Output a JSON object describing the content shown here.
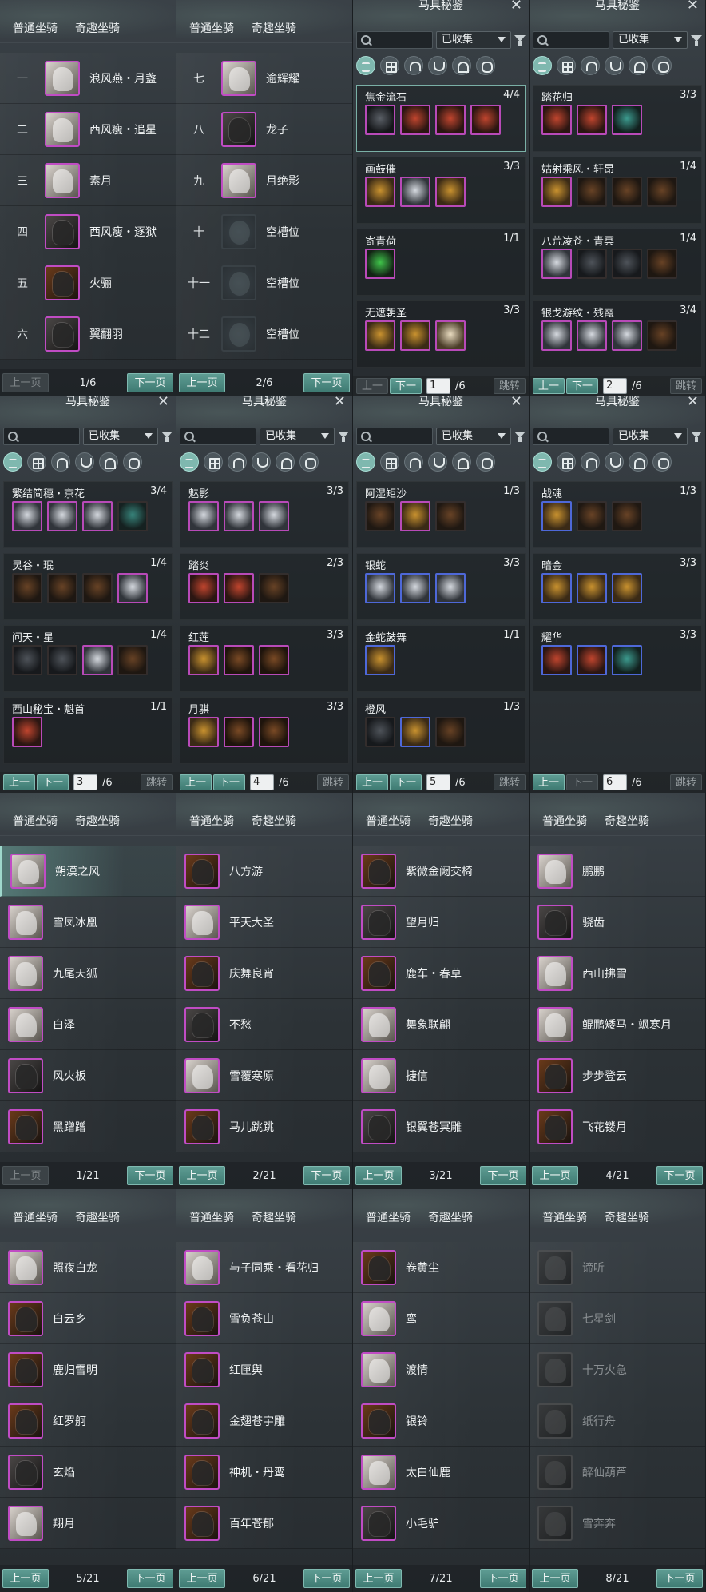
{
  "list_tabs": {
    "normal": "普通坐骑",
    "fun": "奇趣坐骑"
  },
  "nav": {
    "prev": "上一页",
    "next": "下一页",
    "jump": "跳转"
  },
  "comp": {
    "title": "马具秘鉴",
    "filter_value": "已收集",
    "total": "/6"
  },
  "panel_1": {
    "page": "1/6",
    "rows": [
      {
        "num": "一",
        "name": "浪风燕・月盏"
      },
      {
        "num": "二",
        "name": "西风瘦・追星"
      },
      {
        "num": "三",
        "name": "素月"
      },
      {
        "num": "四",
        "name": "西风瘦・逐狱"
      },
      {
        "num": "五",
        "name": "火骊"
      },
      {
        "num": "六",
        "name": "翼翻羽"
      }
    ]
  },
  "panel_2": {
    "page": "2/6",
    "rows": [
      {
        "num": "七",
        "name": "逾辉耀"
      },
      {
        "num": "八",
        "name": "龙子"
      },
      {
        "num": "九",
        "name": "月绝影"
      },
      {
        "num": "十",
        "name": "空槽位"
      },
      {
        "num": "十一",
        "name": "空槽位"
      },
      {
        "num": "十二",
        "name": "空槽位"
      }
    ]
  },
  "panel_3": {
    "page_input": "1",
    "sets": [
      {
        "name": "焦金流石",
        "count": "4/4"
      },
      {
        "name": "画鼓催",
        "count": "3/3"
      },
      {
        "name": "寄青荷",
        "count": "1/1"
      },
      {
        "name": "无遮朝圣",
        "count": "3/3"
      }
    ]
  },
  "panel_4": {
    "page_input": "2",
    "sets": [
      {
        "name": "踏花归",
        "count": "3/3"
      },
      {
        "name": "姑射乘风・轩昂",
        "count": "1/4"
      },
      {
        "name": "八荒凌苍・青冥",
        "count": "1/4"
      },
      {
        "name": "银戈游纹・残霞",
        "count": "3/4"
      }
    ]
  },
  "panel_5": {
    "page_input": "3",
    "sets": [
      {
        "name": "繁结简穗・京花",
        "count": "3/4"
      },
      {
        "name": "灵谷・珉",
        "count": "1/4"
      },
      {
        "name": "问天・星",
        "count": "1/4"
      },
      {
        "name": "西山秘宝・魁首",
        "count": "1/1"
      }
    ]
  },
  "panel_6": {
    "page_input": "4",
    "sets": [
      {
        "name": "魅影",
        "count": "3/3"
      },
      {
        "name": "踏炎",
        "count": "2/3"
      },
      {
        "name": "红莲",
        "count": "3/3"
      },
      {
        "name": "月骐",
        "count": "3/3"
      }
    ]
  },
  "panel_7": {
    "page_input": "5",
    "sets": [
      {
        "name": "阿湿矩沙",
        "count": "1/3"
      },
      {
        "name": "银蛇",
        "count": "3/3"
      },
      {
        "name": "金蛇鼓舞",
        "count": "1/1"
      },
      {
        "name": "橙风",
        "count": "1/3"
      }
    ]
  },
  "panel_8": {
    "page_input": "6",
    "sets": [
      {
        "name": "战魂",
        "count": "1/3"
      },
      {
        "name": "暗金",
        "count": "3/3"
      },
      {
        "name": "耀华",
        "count": "3/3"
      }
    ]
  },
  "panel_9": {
    "page": "1/21",
    "rows": [
      "朔漠之风",
      "雪凤冰凰",
      "九尾天狐",
      "白泽",
      "风火板",
      "黑蹭蹭"
    ]
  },
  "panel_10": {
    "page": "2/21",
    "rows": [
      "八方游",
      "平天大圣",
      "庆舞良宵",
      "不愁",
      "雪覆寒原",
      "马儿跳跳"
    ]
  },
  "panel_11": {
    "page": "3/21",
    "rows": [
      "紫微金阙交椅",
      "望月归",
      "鹿车・春草",
      "舞象联翩",
      "捷信",
      "银翼苍冥雕"
    ]
  },
  "panel_12": {
    "page": "4/21",
    "rows": [
      "鹏鹏",
      "骁齿",
      "西山拂雪",
      "鲲鹏矮马・飒寒月",
      "步步登云",
      "飞花镂月"
    ]
  },
  "panel_13": {
    "page": "5/21",
    "rows": [
      "照夜白龙",
      "白云乡",
      "鹿归雪明",
      "红罗舸",
      "玄焰",
      "翔月"
    ]
  },
  "panel_14": {
    "page": "6/21",
    "rows": [
      "与子同乘・看花归",
      "雪负苍山",
      "红匣舆",
      "金翅苍宇雕",
      "神机・丹鸾",
      "百年苍郁"
    ]
  },
  "panel_15": {
    "page": "7/21",
    "rows": [
      "卷黄尘",
      "鸾",
      "渡情",
      "银铃",
      "太白仙鹿",
      "小毛驴"
    ]
  },
  "panel_16": {
    "page": "8/21",
    "rows": [
      "谛听",
      "七星剑",
      "十万火急",
      "纸行舟",
      "醉仙葫芦",
      "雪奔奔"
    ]
  }
}
